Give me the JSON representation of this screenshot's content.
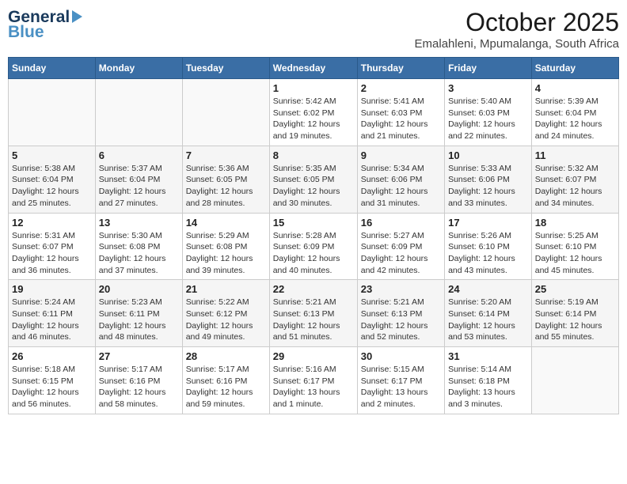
{
  "header": {
    "logo_general": "General",
    "logo_blue": "Blue",
    "title": "October 2025",
    "subtitle": "Emalahleni, Mpumalanga, South Africa"
  },
  "weekdays": [
    "Sunday",
    "Monday",
    "Tuesday",
    "Wednesday",
    "Thursday",
    "Friday",
    "Saturday"
  ],
  "weeks": [
    [
      {
        "day": "",
        "info": ""
      },
      {
        "day": "",
        "info": ""
      },
      {
        "day": "",
        "info": ""
      },
      {
        "day": "1",
        "info": "Sunrise: 5:42 AM\nSunset: 6:02 PM\nDaylight: 12 hours\nand 19 minutes."
      },
      {
        "day": "2",
        "info": "Sunrise: 5:41 AM\nSunset: 6:03 PM\nDaylight: 12 hours\nand 21 minutes."
      },
      {
        "day": "3",
        "info": "Sunrise: 5:40 AM\nSunset: 6:03 PM\nDaylight: 12 hours\nand 22 minutes."
      },
      {
        "day": "4",
        "info": "Sunrise: 5:39 AM\nSunset: 6:04 PM\nDaylight: 12 hours\nand 24 minutes."
      }
    ],
    [
      {
        "day": "5",
        "info": "Sunrise: 5:38 AM\nSunset: 6:04 PM\nDaylight: 12 hours\nand 25 minutes."
      },
      {
        "day": "6",
        "info": "Sunrise: 5:37 AM\nSunset: 6:04 PM\nDaylight: 12 hours\nand 27 minutes."
      },
      {
        "day": "7",
        "info": "Sunrise: 5:36 AM\nSunset: 6:05 PM\nDaylight: 12 hours\nand 28 minutes."
      },
      {
        "day": "8",
        "info": "Sunrise: 5:35 AM\nSunset: 6:05 PM\nDaylight: 12 hours\nand 30 minutes."
      },
      {
        "day": "9",
        "info": "Sunrise: 5:34 AM\nSunset: 6:06 PM\nDaylight: 12 hours\nand 31 minutes."
      },
      {
        "day": "10",
        "info": "Sunrise: 5:33 AM\nSunset: 6:06 PM\nDaylight: 12 hours\nand 33 minutes."
      },
      {
        "day": "11",
        "info": "Sunrise: 5:32 AM\nSunset: 6:07 PM\nDaylight: 12 hours\nand 34 minutes."
      }
    ],
    [
      {
        "day": "12",
        "info": "Sunrise: 5:31 AM\nSunset: 6:07 PM\nDaylight: 12 hours\nand 36 minutes."
      },
      {
        "day": "13",
        "info": "Sunrise: 5:30 AM\nSunset: 6:08 PM\nDaylight: 12 hours\nand 37 minutes."
      },
      {
        "day": "14",
        "info": "Sunrise: 5:29 AM\nSunset: 6:08 PM\nDaylight: 12 hours\nand 39 minutes."
      },
      {
        "day": "15",
        "info": "Sunrise: 5:28 AM\nSunset: 6:09 PM\nDaylight: 12 hours\nand 40 minutes."
      },
      {
        "day": "16",
        "info": "Sunrise: 5:27 AM\nSunset: 6:09 PM\nDaylight: 12 hours\nand 42 minutes."
      },
      {
        "day": "17",
        "info": "Sunrise: 5:26 AM\nSunset: 6:10 PM\nDaylight: 12 hours\nand 43 minutes."
      },
      {
        "day": "18",
        "info": "Sunrise: 5:25 AM\nSunset: 6:10 PM\nDaylight: 12 hours\nand 45 minutes."
      }
    ],
    [
      {
        "day": "19",
        "info": "Sunrise: 5:24 AM\nSunset: 6:11 PM\nDaylight: 12 hours\nand 46 minutes."
      },
      {
        "day": "20",
        "info": "Sunrise: 5:23 AM\nSunset: 6:11 PM\nDaylight: 12 hours\nand 48 minutes."
      },
      {
        "day": "21",
        "info": "Sunrise: 5:22 AM\nSunset: 6:12 PM\nDaylight: 12 hours\nand 49 minutes."
      },
      {
        "day": "22",
        "info": "Sunrise: 5:21 AM\nSunset: 6:13 PM\nDaylight: 12 hours\nand 51 minutes."
      },
      {
        "day": "23",
        "info": "Sunrise: 5:21 AM\nSunset: 6:13 PM\nDaylight: 12 hours\nand 52 minutes."
      },
      {
        "day": "24",
        "info": "Sunrise: 5:20 AM\nSunset: 6:14 PM\nDaylight: 12 hours\nand 53 minutes."
      },
      {
        "day": "25",
        "info": "Sunrise: 5:19 AM\nSunset: 6:14 PM\nDaylight: 12 hours\nand 55 minutes."
      }
    ],
    [
      {
        "day": "26",
        "info": "Sunrise: 5:18 AM\nSunset: 6:15 PM\nDaylight: 12 hours\nand 56 minutes."
      },
      {
        "day": "27",
        "info": "Sunrise: 5:17 AM\nSunset: 6:16 PM\nDaylight: 12 hours\nand 58 minutes."
      },
      {
        "day": "28",
        "info": "Sunrise: 5:17 AM\nSunset: 6:16 PM\nDaylight: 12 hours\nand 59 minutes."
      },
      {
        "day": "29",
        "info": "Sunrise: 5:16 AM\nSunset: 6:17 PM\nDaylight: 13 hours\nand 1 minute."
      },
      {
        "day": "30",
        "info": "Sunrise: 5:15 AM\nSunset: 6:17 PM\nDaylight: 13 hours\nand 2 minutes."
      },
      {
        "day": "31",
        "info": "Sunrise: 5:14 AM\nSunset: 6:18 PM\nDaylight: 13 hours\nand 3 minutes."
      },
      {
        "day": "",
        "info": ""
      }
    ]
  ]
}
